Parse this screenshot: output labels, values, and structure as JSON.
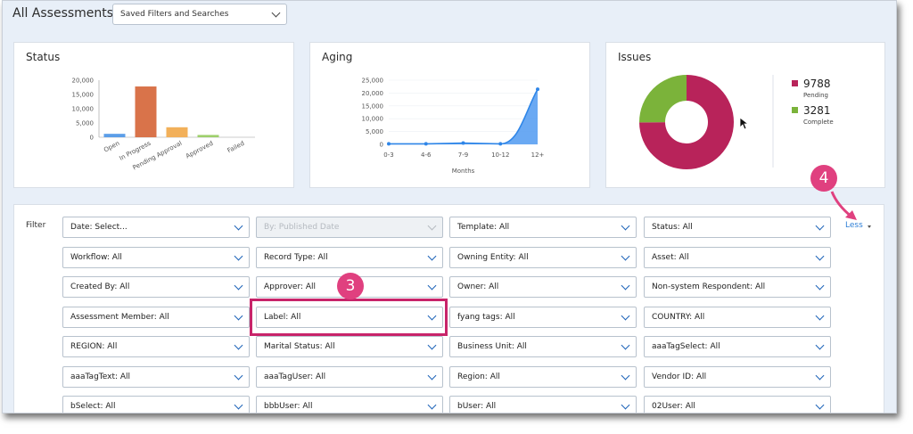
{
  "header": {
    "title": "All Assessments",
    "saved_filters_label": "Saved Filters and Searches"
  },
  "cards": {
    "status": {
      "title": "Status"
    },
    "aging": {
      "title": "Aging"
    },
    "issues": {
      "title": "Issues"
    }
  },
  "chart_data": [
    {
      "type": "bar",
      "title": "Status",
      "categories": [
        "Open",
        "In Progress",
        "Pending Approval",
        "Approved",
        "Failed"
      ],
      "values": [
        1200,
        17800,
        3500,
        800,
        0
      ],
      "colors": [
        "#5c9ee8",
        "#d9734a",
        "#f2b05a",
        "#9dcf6b",
        "#cccccc"
      ],
      "ylim": [
        0,
        20000
      ],
      "yticks": [
        "20,000",
        "15,000",
        "10,000",
        "5,000",
        "0"
      ]
    },
    {
      "type": "area",
      "title": "Aging",
      "xlabel": "Months",
      "categories": [
        "0-3",
        "4-6",
        "7-9",
        "10-12",
        "12+"
      ],
      "values": [
        200,
        200,
        500,
        200,
        21500
      ],
      "ylim": [
        0,
        25000
      ],
      "yticks": [
        "25,000",
        "20,000",
        "15,000",
        "10,000",
        "5,000",
        "0"
      ],
      "color": "#5aa0f2"
    },
    {
      "type": "pie",
      "title": "Issues",
      "slices": [
        {
          "label": "Pending",
          "value": 9788,
          "value_text": "9788",
          "color": "#b8235a"
        },
        {
          "label": "Complete",
          "value": 3281,
          "value_text": "3281",
          "color": "#7bb33a"
        }
      ]
    }
  ],
  "filters": {
    "label": "Filter",
    "less_label": "Less",
    "items": [
      "Date: Select...",
      "By: Published Date",
      "Template: All",
      "Status: All",
      "Workflow: All",
      "Record Type: All",
      "Owning Entity: All",
      "Asset: All",
      "Created By: All",
      "Approver: All",
      "Owner: All",
      "Non-system Respondent: All",
      "Assessment Member: All",
      "Label: All",
      "fyang tags: All",
      "COUNTRY: All",
      "REGION: All",
      "Marital Status: All",
      "Business Unit: All",
      "aaaTagSelect: All",
      "aaaTagText: All",
      "aaaTagUser: All",
      "Region: All",
      "Vendor ID: All",
      "bSelect: All",
      "bbbUser: All",
      "bUser: All",
      "02User: All"
    ],
    "disabled_index": 1
  },
  "annotations": {
    "badge_3": "3",
    "badge_4": "4"
  }
}
